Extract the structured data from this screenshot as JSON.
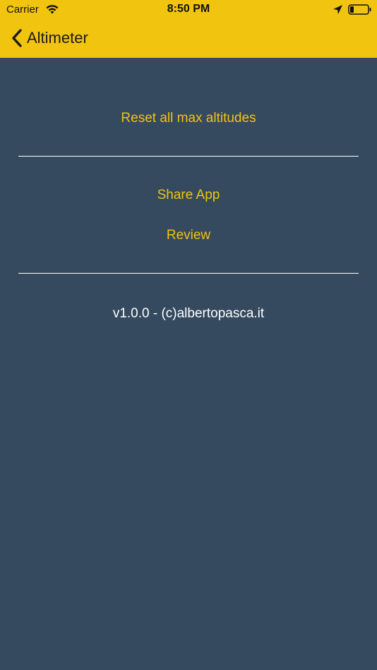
{
  "status_bar": {
    "carrier": "Carrier",
    "time": "8:50 PM",
    "icons": [
      "wifi-icon",
      "location-icon",
      "battery-icon"
    ]
  },
  "nav": {
    "back_label": "Altimeter",
    "back_icon": "chevron-left-icon"
  },
  "menu": {
    "reset_label": "Reset all max altitudes",
    "share_label": "Share App",
    "review_label": "Review"
  },
  "footer": {
    "version_text": "v1.0.0 - (c)albertopasca.it"
  },
  "colors": {
    "accent": "#F1C40F",
    "background": "#354A5F",
    "divider": "#FFFFFF",
    "text_light": "#FFFFFF"
  }
}
